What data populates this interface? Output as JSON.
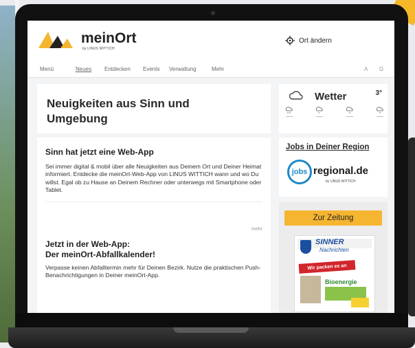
{
  "brand": {
    "name": "meinOrt",
    "sub": "by LINUS WITTICH",
    "accent": "#f6b531"
  },
  "location": {
    "label": "Ort ändern",
    "icon": "crosshair-icon"
  },
  "nav": {
    "items": [
      "Menü",
      "Neues",
      "Entdecken",
      "Events",
      "Verwaltung",
      "Mehr"
    ],
    "utility": [
      "A",
      "Ω"
    ]
  },
  "main": {
    "heading": "Neuigkeiten aus Sinn und Umgebung",
    "posts": [
      {
        "title": "Sinn hat jetzt eine Web-App",
        "text": "Sei immer digital & mobil über alle Neuigkeiten aus Deinem Ort und Deiner Heimat informiert. Entdecke die meinOrt-Web-App von LINUS WITTICH wann und wo Du willst. Egal ob zu Hause an Deinem Rechner oder unterwegs mit Smartphone oder Tablet.",
        "more": "mehr"
      },
      {
        "title": "Jetzt in der Web-App:\nDer meinOrt-Abfallkalender!",
        "text": "Verpasse keinen Abfalltermin mehr für Deinen Bezirk. Nutze die praktischen Push-Benachrichtigungen in Deiner meinOrt-App."
      }
    ]
  },
  "weather": {
    "title": "Wetter",
    "temp": "3°"
  },
  "jobs": {
    "heading": "Jobs in Deiner Region",
    "logo_word": "regional.de",
    "logo_circle": "jobs",
    "logo_sub": "by LINUS WITTICH"
  },
  "newspaper": {
    "button": "Zur Zeitung",
    "cover_title": "SINNER",
    "cover_sub": "Nachrichten",
    "cover_banner": "Wir packen es an",
    "cover_green": "Bioenergie"
  }
}
